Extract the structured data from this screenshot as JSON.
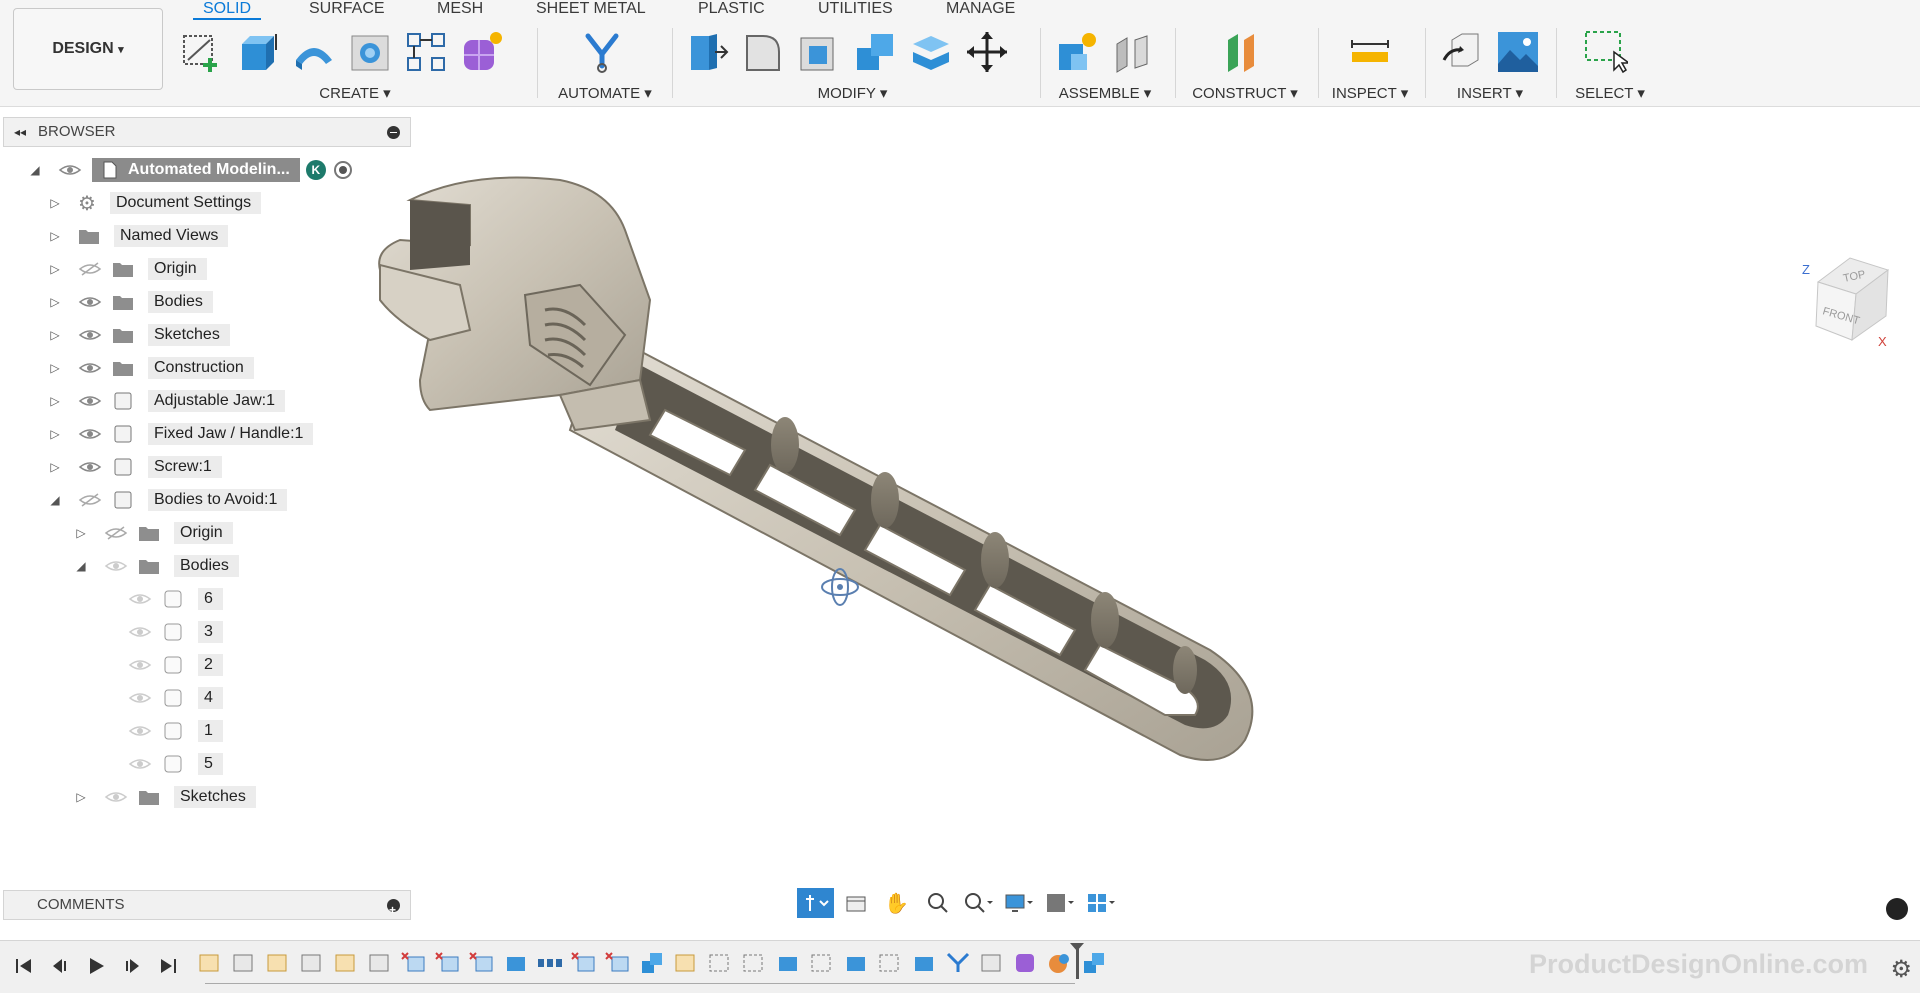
{
  "workspace_button": {
    "label": "DESIGN",
    "caret": "▾"
  },
  "tabs": [
    {
      "label": "SOLID",
      "active": true
    },
    {
      "label": "SURFACE"
    },
    {
      "label": "MESH"
    },
    {
      "label": "SHEET METAL"
    },
    {
      "label": "PLASTIC"
    },
    {
      "label": "UTILITIES"
    },
    {
      "label": "MANAGE"
    }
  ],
  "groups": {
    "create": "CREATE ▾",
    "automate": "AUTOMATE ▾",
    "modify": "MODIFY ▾",
    "assemble": "ASSEMBLE ▾",
    "construct": "CONSTRUCT ▾",
    "inspect": "INSPECT ▾",
    "insert": "INSERT ▾",
    "select": "SELECT ▾"
  },
  "browser": {
    "title": "BROWSER",
    "root": {
      "label": "Automated Modelin...",
      "badge": "K"
    },
    "items": [
      {
        "label": "Document Settings"
      },
      {
        "label": "Named Views"
      },
      {
        "label": "Origin"
      },
      {
        "label": "Bodies"
      },
      {
        "label": "Sketches"
      },
      {
        "label": "Construction"
      },
      {
        "label": "Adjustable Jaw:1"
      },
      {
        "label": "Fixed Jaw / Handle:1"
      },
      {
        "label": "Screw:1"
      },
      {
        "label": "Bodies to Avoid:1"
      },
      {
        "label": "Origin"
      },
      {
        "label": "Bodies"
      },
      {
        "label": "6"
      },
      {
        "label": "3"
      },
      {
        "label": "2"
      },
      {
        "label": "4"
      },
      {
        "label": "1"
      },
      {
        "label": "5"
      },
      {
        "label": "Sketches"
      }
    ]
  },
  "comments": {
    "title": "COMMENTS"
  },
  "viewcube": {
    "top": "TOP",
    "front": "FRONT",
    "z": "Z",
    "x": "X"
  },
  "watermark": "ProductDesignOnline.com",
  "colors": {
    "accent": "#0a7ad8",
    "model": "#cfc9bd"
  }
}
